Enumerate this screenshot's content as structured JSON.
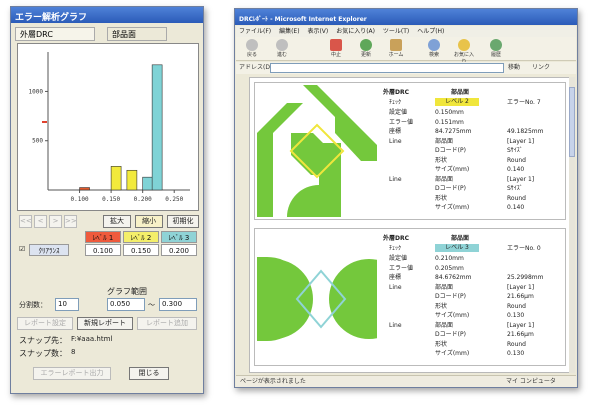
{
  "left_window": {
    "title": "エラー解析グラフ",
    "tabs": [
      "外層DRC",
      "部品面"
    ],
    "chart_data": {
      "type": "bar",
      "x_ticks": [
        "0.100",
        "0.150",
        "0.200",
        "0.250"
      ],
      "y_ticks": [
        "1000",
        "500"
      ],
      "series": [
        {
          "name": "ﾚﾍﾞﾙ 1",
          "color": "#e25a2c",
          "values": [
            {
              "x": 0.1,
              "y": 25
            },
            {
              "x": 0.15,
              "y": 0
            }
          ]
        },
        {
          "name": "ﾚﾍﾞﾙ 2",
          "color": "#f2ea3c",
          "values": [
            {
              "x": 0.15,
              "y": 240
            },
            {
              "x": 0.175,
              "y": 200
            }
          ]
        },
        {
          "name": "ﾚﾍﾞﾙ 3",
          "color": "#7fd3d6",
          "values": [
            {
              "x": 0.2,
              "y": 130
            },
            {
              "x": 0.215,
              "y": 1270
            }
          ]
        }
      ],
      "xlim": [
        0.05,
        0.275
      ],
      "ylim": [
        0,
        1400
      ]
    },
    "buttons": {
      "zoom": "拡大",
      "shrink": "縮小",
      "initial": "初期化"
    },
    "nav_arrows": [
      "<<",
      "<",
      ">",
      ">>"
    ],
    "levels": [
      "ﾚﾍﾞﾙ 1",
      "ﾚﾍﾞﾙ 2",
      "ﾚﾍﾞﾙ 3"
    ],
    "level_colors": [
      "#ef5a3c",
      "#f4ef6a",
      "#8fd3d6"
    ],
    "clearance_label": "ｸﾘｱﾗﾝｽ",
    "level_values": [
      "0.100",
      "0.150",
      "0.200"
    ],
    "graph_range_label": "グラフ範囲",
    "split_label": "分割数：",
    "split_value": "10",
    "range_from": "0.050",
    "range_to": "0.300",
    "range_sep": "～",
    "report_setting_btn": "レポート設定",
    "new_report_btn": "新規レポート",
    "report_add_btn": "レポート追加",
    "snap_dest_label": "スナップ先：",
    "snap_dest_value": "F:¥aaa.html",
    "snap_count_label": "スナップ数：",
    "snap_count_value": "8",
    "error_report_btn": "エラーレポート出力",
    "close_btn": "閉じる"
  },
  "right_window": {
    "title": "DRCﾚﾎﾟｰﾄ - Microsoft Internet Explorer",
    "menu": [
      "ファイル(F)",
      "編集(E)",
      "表示(V)",
      "お気に入り(A)",
      "ツール(T)",
      "ヘルプ(H)"
    ],
    "toolbar": [
      "戻る",
      "進む",
      "中止",
      "更新",
      "ホーム",
      "検索",
      "お気に入り",
      "履歴"
    ],
    "address_label": "アドレス(D)",
    "go_label": "移動",
    "links_label": "リンク",
    "status_text": "ページが表示されました",
    "zone_text": "マイ コンピュータ",
    "panels": [
      {
        "header": "外層DRC",
        "side": "部品面",
        "check_label": "ﾁｪｯｸ",
        "level": "レベル 2",
        "level_color": "#f0e63c",
        "error_no": "エラーNo. 7",
        "rows": [
          [
            "設定値",
            "0.150mm",
            ""
          ],
          [
            "エラー値",
            "0.151mm",
            ""
          ],
          [
            "座標",
            "84.7275mm",
            "49.1825mm"
          ],
          [
            "Line",
            "部品面",
            "[Layer 1]"
          ],
          [
            "",
            "Dコード(P)",
            "Sｻｲｽﾞ"
          ],
          [
            "",
            "形状",
            "Round"
          ],
          [
            "",
            "サイズ(mm)",
            "0.140"
          ],
          [
            "Line",
            "部品面",
            "[Layer 1]"
          ],
          [
            "",
            "Dコード(P)",
            "Sｻｲｽﾞ"
          ],
          [
            "",
            "形状",
            "Round"
          ],
          [
            "",
            "サイズ(mm)",
            "0.140"
          ]
        ]
      },
      {
        "header": "外層DRC",
        "side": "部品面",
        "check_label": "ﾁｪｯｸ",
        "level": "レベル 3",
        "level_color": "#8fd3d6",
        "error_no": "エラーNo. 0",
        "rows": [
          [
            "設定値",
            "0.210mm",
            ""
          ],
          [
            "エラー値",
            "0.205mm",
            ""
          ],
          [
            "座標",
            "84.6762mm",
            "25.2998mm"
          ],
          [
            "Line",
            "部品面",
            "[Layer 1]"
          ],
          [
            "",
            "Dコード(P)",
            "21.66μm"
          ],
          [
            "",
            "形状",
            "Round"
          ],
          [
            "",
            "サイズ(mm)",
            "0.130"
          ],
          [
            "Line",
            "部品面",
            "[Layer 1]"
          ],
          [
            "",
            "Dコード(P)",
            "21.66μm"
          ],
          [
            "",
            "形状",
            "Round"
          ],
          [
            "",
            "サイズ(mm)",
            "0.130"
          ]
        ]
      }
    ]
  }
}
